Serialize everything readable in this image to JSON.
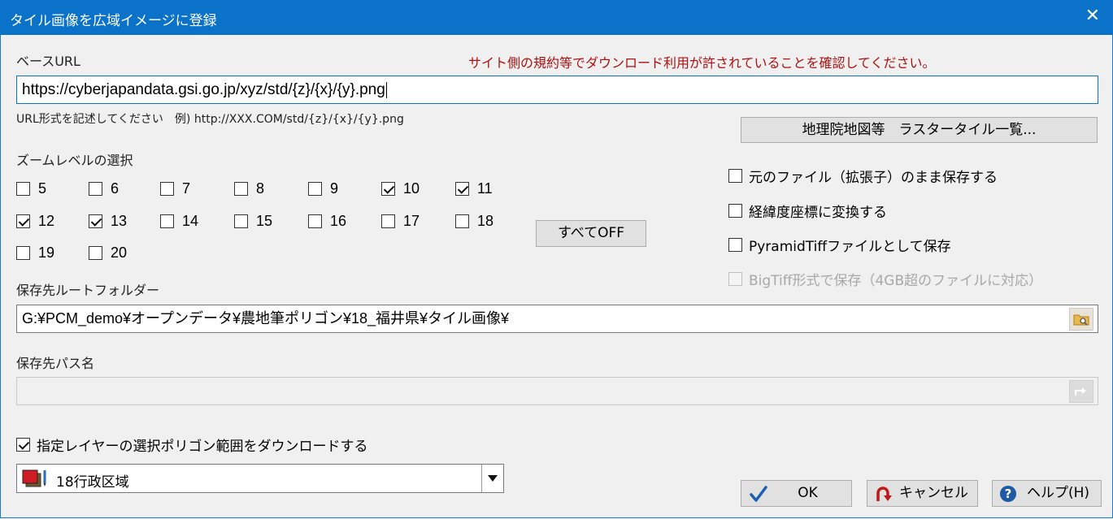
{
  "window": {
    "title": "タイル画像を広域イメージに登録",
    "close_glyph": "✕"
  },
  "base_url": {
    "label": "ベースURL",
    "warning": "サイト側の規約等でダウンロード利用が許されていることを確認してください。",
    "value": "https://cyberjapandata.gsi.go.jp/xyz/std/{z}/{x}/{y}.png",
    "hint": "URL形式を記述してください　例) http://XXX.COM/std/{z}/{x}/{y}.png",
    "list_button": "地理院地図等　ラスタータイル一覧..."
  },
  "zoom": {
    "label": "ズームレベルの選択",
    "levels": [
      {
        "value": "5",
        "checked": false
      },
      {
        "value": "6",
        "checked": false
      },
      {
        "value": "7",
        "checked": false
      },
      {
        "value": "8",
        "checked": false
      },
      {
        "value": "9",
        "checked": false
      },
      {
        "value": "10",
        "checked": true
      },
      {
        "value": "11",
        "checked": true
      },
      {
        "value": "12",
        "checked": true
      },
      {
        "value": "13",
        "checked": true
      },
      {
        "value": "14",
        "checked": false
      },
      {
        "value": "15",
        "checked": false
      },
      {
        "value": "16",
        "checked": false
      },
      {
        "value": "17",
        "checked": false
      },
      {
        "value": "18",
        "checked": false
      },
      {
        "value": "19",
        "checked": false
      },
      {
        "value": "20",
        "checked": false
      }
    ],
    "all_off_button": "すべてOFF"
  },
  "options": [
    {
      "label": "元のファイル（拡張子）のまま保存する",
      "checked": false,
      "enabled": true
    },
    {
      "label": "経緯度座標に変換する",
      "checked": false,
      "enabled": true
    },
    {
      "label": "PyramidTiffファイルとして保存",
      "checked": false,
      "enabled": true
    },
    {
      "label": "BigTiff形式で保存（4GB超のファイルに対応）",
      "checked": false,
      "enabled": false
    }
  ],
  "save_root": {
    "label": "保存先ルートフォルダー",
    "value": "G:¥PCM_demo¥オープンデータ¥農地筆ポリゴン¥18_福井県¥タイル画像¥"
  },
  "save_path": {
    "label": "保存先パス名",
    "value": ""
  },
  "polygon_download": {
    "label": "指定レイヤーの選択ポリゴン範囲をダウンロードする",
    "checked": true
  },
  "layer_select": {
    "value": "18行政区域"
  },
  "buttons": {
    "ok": "OK",
    "cancel": "キャンセル",
    "help": "ヘルプ(H)"
  },
  "colors": {
    "titlebar": "#0a72c8",
    "warning": "#b01010",
    "ok_check": "#1a5fb4",
    "cancel_icon": "#c01818",
    "help_icon": "#1f5aa6"
  }
}
